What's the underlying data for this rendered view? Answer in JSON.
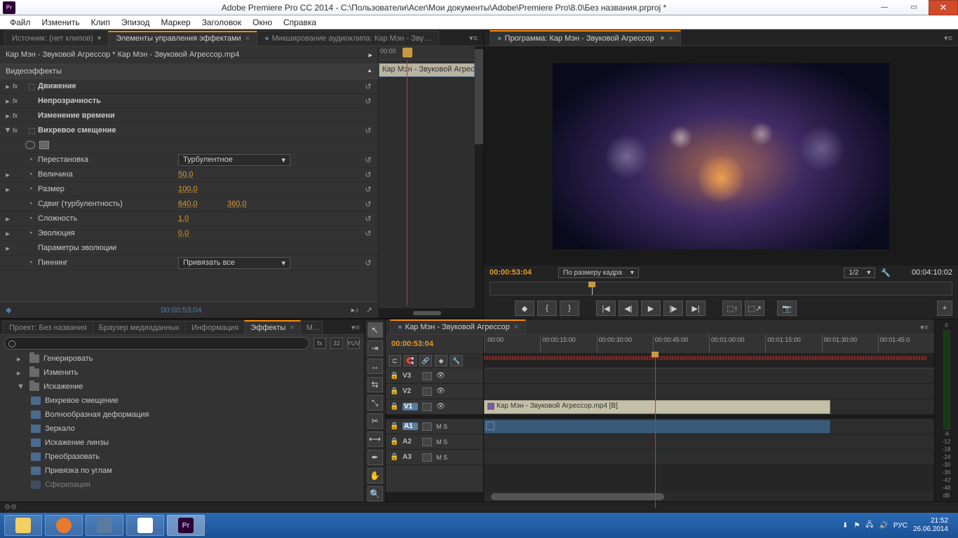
{
  "titlebar": {
    "app_badge": "Pr",
    "title": "Adobe Premiere Pro CC 2014 - C:\\Пользователи\\Acer\\Мои документы\\Adobe\\Premiere Pro\\8.0\\Без названия.prproj *"
  },
  "menubar": [
    "Файл",
    "Изменить",
    "Клип",
    "Эпизод",
    "Маркер",
    "Заголовок",
    "Окно",
    "Справка"
  ],
  "source_tabs": {
    "source": "Источник: (нет клипов)",
    "effect_controls": "Элементы управления эффектами",
    "audio_mixer": "Микширование аудиоклипа: Кар Мэн - Звуков"
  },
  "effect_controls": {
    "clip_path": "Кар Мэн - Звуковой Агрессор * Кар Мэн - Звуковой Агрессор.mp4",
    "section_title": "Видеоэффекты",
    "motion": "Движение",
    "opacity": "Непрозрачность",
    "time_remap": "Изменение времени",
    "twirl": "Вихревое смещение",
    "perm_label": "Перестановка",
    "perm_value": "Турбулентное",
    "amount_label": "Величина",
    "amount_value": "50,0",
    "size_label": "Размер",
    "size_value": "100,0",
    "offset_label": "Сдвиг (турбулентность)",
    "offset_x": "640,0",
    "offset_y": "360,0",
    "complex_label": "Сложность",
    "complex_value": "1,0",
    "evo_label": "Эволюция",
    "evo_value": "0,0",
    "evo_params": "Параметры эволюции",
    "pinning_label": "Пиннинг",
    "pinning_value": "Привязать все",
    "footer_tc": "00:00:53:04",
    "mini_ruler_time": "00:00",
    "mini_clip": "Кар Мэн - Звуковой Агрессо"
  },
  "program": {
    "tab": "Программа: Кар Мэн - Звуковой Агрессор",
    "tc_left": "00:00:53:04",
    "fit_label": "По размеру кадра",
    "res_label": "1/2",
    "tc_right": "00:04:10:02"
  },
  "bottom_tabs": {
    "project": "Проект: Без названия",
    "media": "Браузер медиаданных",
    "info": "Информация",
    "effects": "Эффекты",
    "markers_short": "М"
  },
  "effects_panel": {
    "search_placeholder": "",
    "icon_labels": [
      "fx",
      "32",
      "YUV"
    ],
    "folders": {
      "generate": "Генерировать",
      "adjust": "Изменить",
      "distort": "Искажение"
    },
    "items": [
      "Вихревое смещение",
      "Волнообразная деформация",
      "Зеркало",
      "Искажение линзы",
      "Преобразовать",
      "Привязка по углам",
      "Сферизация"
    ]
  },
  "timeline": {
    "tab": "Кар Мэн - Звуковой Агрессор",
    "tc": "00:00:53:04",
    "ruler": [
      ":00:00",
      "00:00:15:00",
      "00:00:30:00",
      "00:00:45:00",
      "00:01:00:00",
      "00:01:15:00",
      "00:01:30:00",
      "00:01:45:0"
    ],
    "tracks": {
      "v3": "V3",
      "v2": "V2",
      "v1": "V1",
      "a1": "A1",
      "a2": "A2",
      "a3": "A3"
    },
    "ms": "M   S",
    "clip_name": "Кар Мэн - Звуковой Агрессор.mp4 [В]"
  },
  "meters": [
    "0",
    "-6",
    "-12",
    "-18",
    "-24",
    "-30",
    "-36",
    "-42",
    "-48",
    "dB"
  ],
  "taskbar": {
    "pr": "Pr",
    "lang": "РУС",
    "time": "21:52",
    "date": "26.06.2014"
  }
}
